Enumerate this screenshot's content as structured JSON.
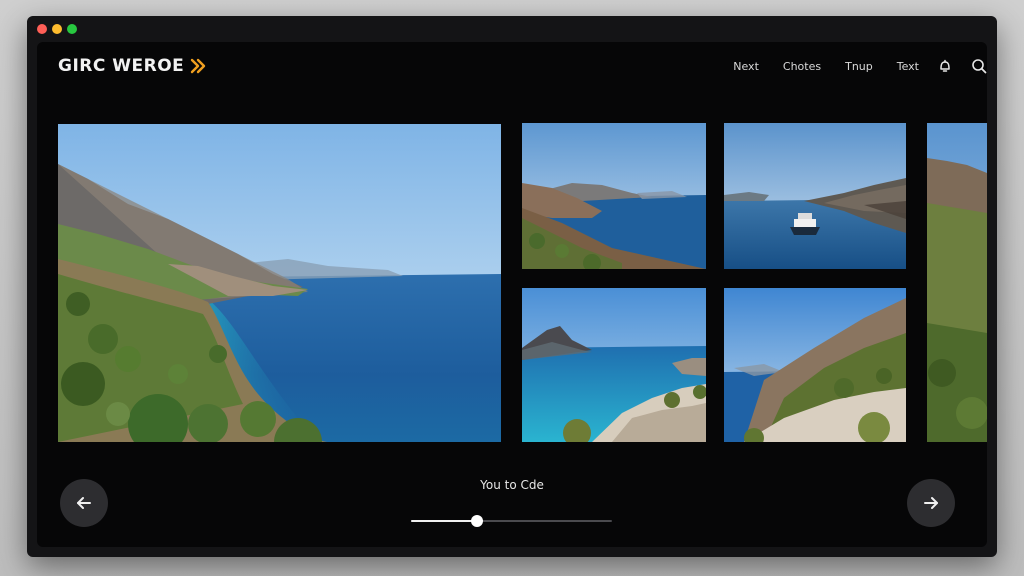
{
  "header": {
    "logo_text": "GIRC WEROE",
    "nav": [
      {
        "label": "Next"
      },
      {
        "label": "Chotes"
      },
      {
        "label": "Tnup"
      },
      {
        "label": "Text"
      }
    ],
    "icons": [
      "notification-icon",
      "search-icon"
    ]
  },
  "gallery": {
    "photos": [
      {
        "subject": "coastal-hillside-panorama"
      },
      {
        "subject": "rocky-shore-bay"
      },
      {
        "subject": "ship-in-bay"
      },
      {
        "subject": "headland-lagoon"
      },
      {
        "subject": "rocky-slope-coast"
      },
      {
        "subject": "mountain-ridge-partial"
      }
    ]
  },
  "caption": "You to Cde",
  "slider": {
    "progress_percent": 33
  },
  "colors": {
    "accent": "#f0a020",
    "window_bg": "#141416",
    "inner_bg": "#060607",
    "button_bg": "#2d2d30"
  }
}
